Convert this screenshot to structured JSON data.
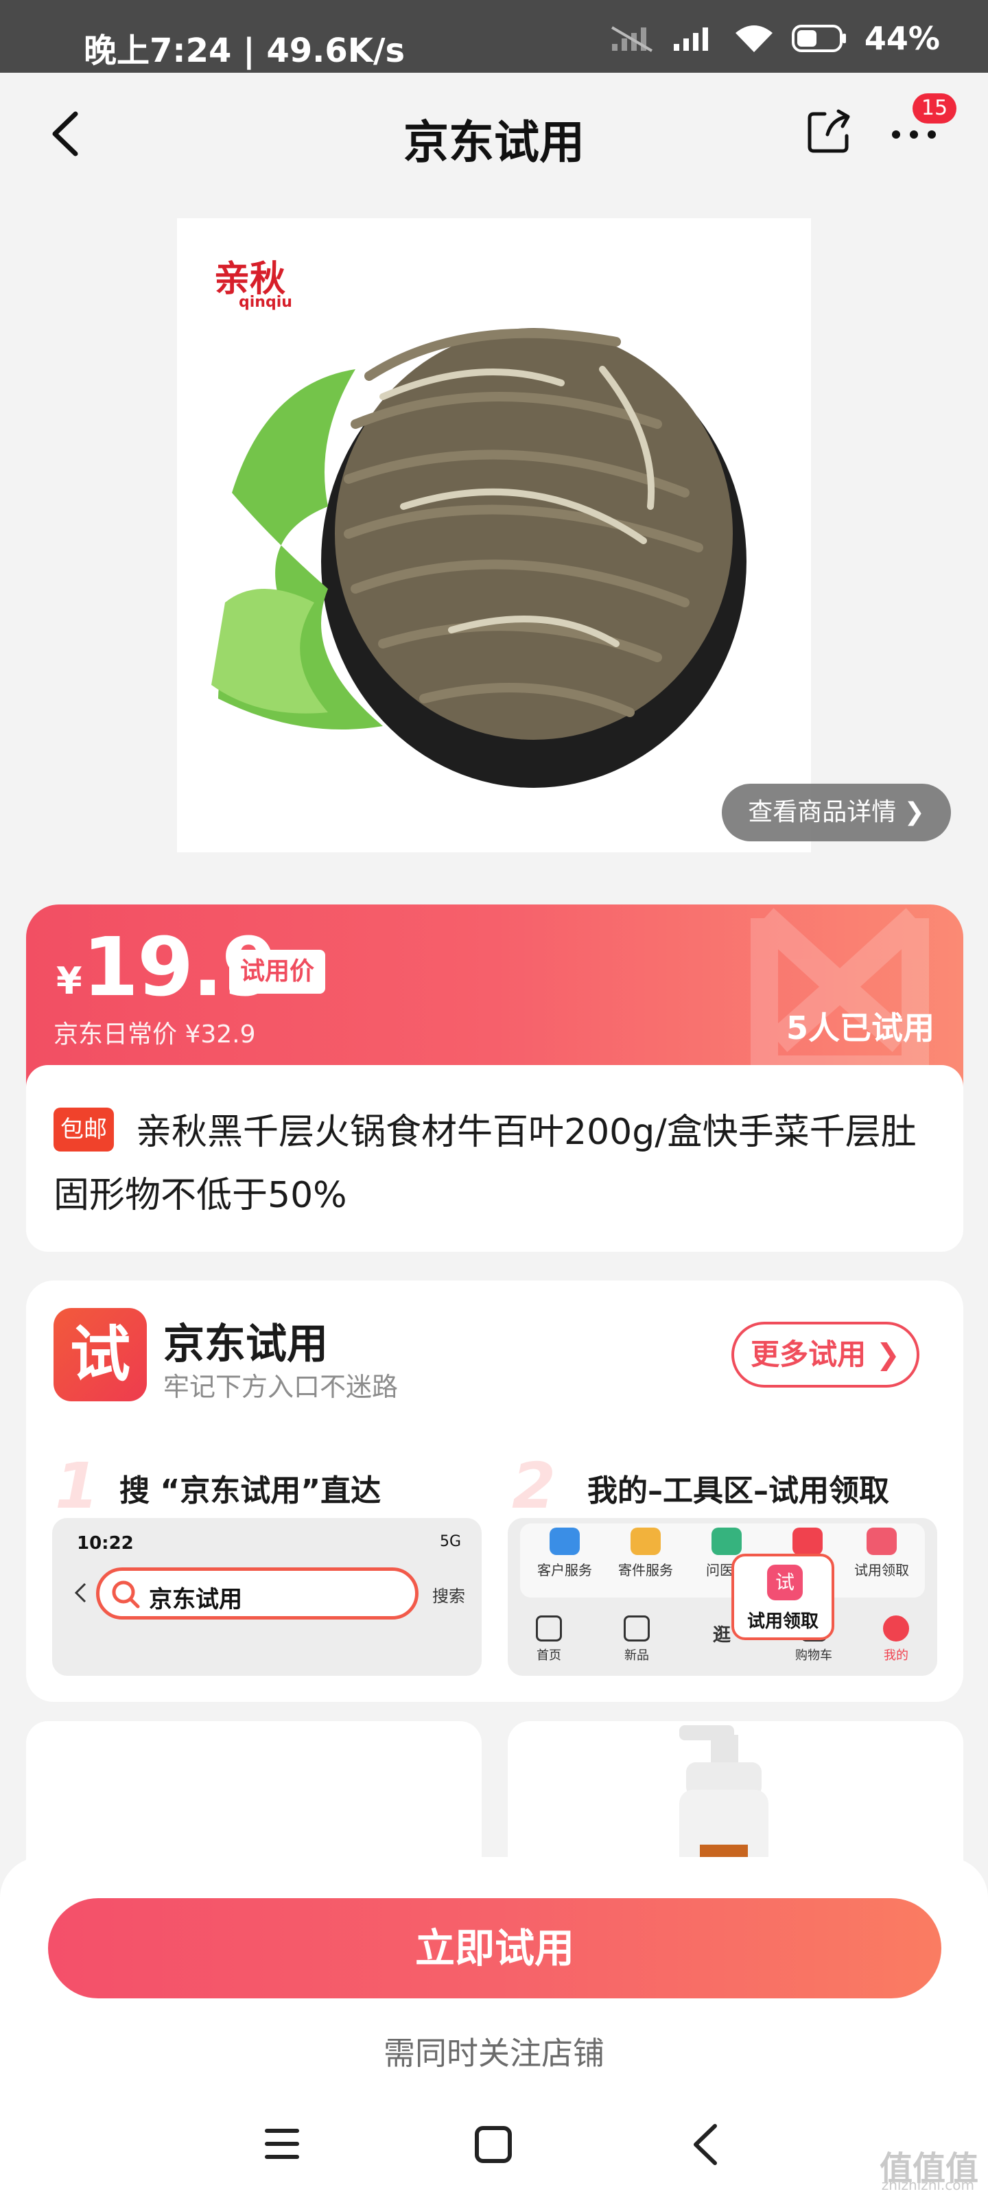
{
  "status_bar": {
    "time_speed": "晚上7:24 | 49.6K/s",
    "battery": "44%"
  },
  "nav": {
    "title": "京东试用",
    "badge": "15"
  },
  "product_image": {
    "brand_cn": "亲秋",
    "brand_en": "qinqiu",
    "view_detail": "查看商品详情 ❯"
  },
  "price": {
    "currency": "¥",
    "value": "19.9",
    "tag": "试用价",
    "regular": "京东日常价 ¥32.9",
    "tried": "5人已试用"
  },
  "product": {
    "badge": "包邮",
    "title": "亲秋黑千层火锅食材牛百叶200g/盒快手菜千层肚 固形物不低于50%"
  },
  "trial_card": {
    "logo": "试",
    "title": "京东试用",
    "subtitle": "牢记下方入口不迷路",
    "more_button": "更多试用 ❯",
    "step1": {
      "num": "1",
      "text": "搜 “京东试用”直达",
      "time": "10:22",
      "status": "5G",
      "search_value": "京东试用",
      "search_button": "搜索"
    },
    "step2": {
      "num": "2",
      "text": "我的–工具区–试用领取",
      "tools": [
        {
          "label": "客户服务",
          "color": "#3a8ee6"
        },
        {
          "label": "寄件服务",
          "color": "#f2b23c"
        },
        {
          "label": "问医生",
          "color": "#36b37e"
        },
        {
          "label": "",
          "color": "#f0424e"
        },
        {
          "label": "试用领取",
          "color": "#f05a6e"
        }
      ],
      "tabs": [
        "首页",
        "新品",
        "逛",
        "购物车",
        "我的"
      ],
      "popup_icon": "试",
      "popup_text": "试用领取"
    }
  },
  "bottom": {
    "cta": "立即试用",
    "note": "需同时关注店铺"
  },
  "watermark": {
    "text": "值值值",
    "url": "zhizhizhi.com"
  }
}
